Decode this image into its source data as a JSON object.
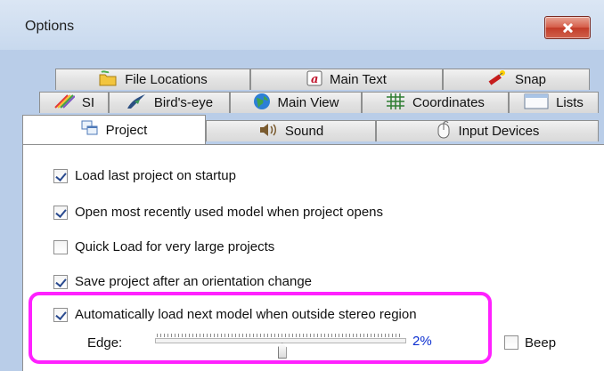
{
  "window": {
    "title": "Options"
  },
  "tabs": {
    "row1": [
      {
        "label": "File Locations",
        "icon": "folder-icon"
      },
      {
        "label": "Main Text",
        "icon": "text-a-icon"
      },
      {
        "label": "Snap",
        "icon": "dynamite-icon"
      }
    ],
    "row2": [
      {
        "label": "SI",
        "icon": "rainbow-icon"
      },
      {
        "label": "Bird's-eye",
        "icon": "bird-icon"
      },
      {
        "label": "Main View",
        "icon": "globe-icon"
      },
      {
        "label": "Coordinates",
        "icon": "grid-icon"
      },
      {
        "label": "Lists",
        "icon": "list-window-icon"
      }
    ],
    "row3": [
      {
        "label": "Project",
        "icon": "project-windows-icon",
        "active": true
      },
      {
        "label": "Sound",
        "icon": "speaker-icon"
      },
      {
        "label": "Input Devices",
        "icon": "mouse-icon"
      }
    ]
  },
  "project": {
    "options": [
      {
        "label": "Load last project on startup",
        "checked": true
      },
      {
        "label": "Open most recently used model when project opens",
        "checked": true
      },
      {
        "label": "Quick Load for very large projects",
        "checked": false
      },
      {
        "label": "Save project after an orientation change",
        "checked": true
      },
      {
        "label": "Automatically load next model when outside stereo region",
        "checked": true
      }
    ],
    "edge": {
      "label": "Edge:",
      "value_text": "2%",
      "slider_fraction": 0.51
    },
    "beep": {
      "label": "Beep",
      "checked": false
    }
  },
  "colors": {
    "highlight": "#ff21ff",
    "percent_text": "#0b2fd1",
    "title_close": "#c23c28"
  }
}
